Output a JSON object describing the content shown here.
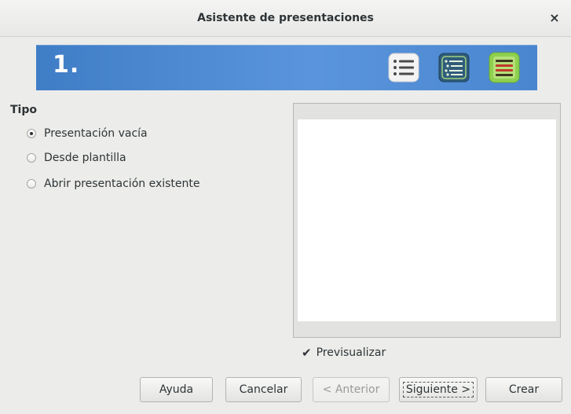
{
  "window": {
    "title": "Asistente de presentaciones",
    "close_glyph": "×"
  },
  "banner": {
    "step": "1.",
    "icons": [
      "list-icon",
      "outline-list-icon",
      "notes-list-icon"
    ],
    "colors": {
      "gradient_start": "#3f7dc6",
      "gradient_end": "#5a95dc"
    }
  },
  "type_section": {
    "title": "Tipo",
    "options": [
      {
        "label": "Presentación vacía",
        "checked": true
      },
      {
        "label": "Desde plantilla",
        "checked": false
      },
      {
        "label": "Abrir presentación existente",
        "checked": false
      }
    ]
  },
  "preview": {
    "checkbox_label": "Previsualizar",
    "checked": true
  },
  "buttons": {
    "help": "Ayuda",
    "cancel": "Cancelar",
    "back": "< Anterior",
    "next": "Siguiente >",
    "create": "Crear"
  }
}
